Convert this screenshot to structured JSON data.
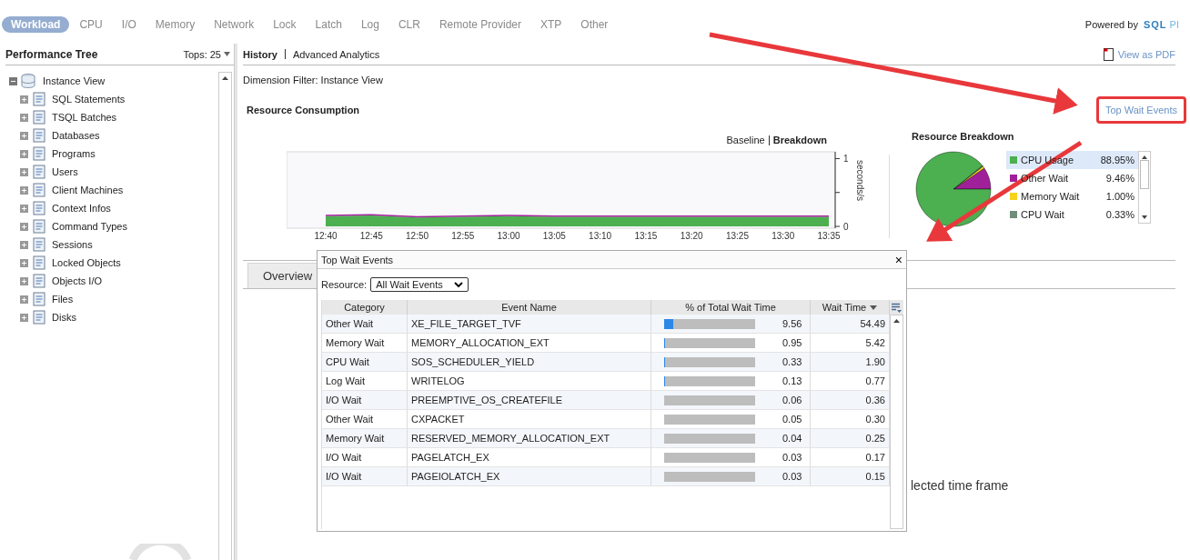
{
  "top_tabs": [
    {
      "label": "Workload",
      "selected": true
    },
    {
      "label": "CPU",
      "selected": false
    },
    {
      "label": "I/O",
      "selected": false
    },
    {
      "label": "Memory",
      "selected": false
    },
    {
      "label": "Network",
      "selected": false
    },
    {
      "label": "Lock",
      "selected": false
    },
    {
      "label": "Latch",
      "selected": false
    },
    {
      "label": "Log",
      "selected": false
    },
    {
      "label": "CLR",
      "selected": false
    },
    {
      "label": "Remote Provider",
      "selected": false
    },
    {
      "label": "XTP",
      "selected": false
    },
    {
      "label": "Other",
      "selected": false
    }
  ],
  "powered_by": {
    "label": "Powered by",
    "logo_main": "SQL",
    "logo_sub": "PI"
  },
  "performance_tree": {
    "title": "Performance Tree",
    "tops_label": "Tops:",
    "tops_value": "25",
    "items": [
      {
        "label": "Instance View",
        "expanded": true,
        "children": [
          {
            "label": "SQL Statements",
            "expanded": false
          },
          {
            "label": "TSQL Batches",
            "expanded": false
          },
          {
            "label": "Databases",
            "expanded": false
          },
          {
            "label": "Programs",
            "expanded": false
          },
          {
            "label": "Users",
            "expanded": false
          },
          {
            "label": "Client Machines",
            "expanded": false
          },
          {
            "label": "Context Infos",
            "expanded": false
          },
          {
            "label": "Command Types",
            "expanded": false
          },
          {
            "label": "Sessions",
            "expanded": false
          },
          {
            "label": "Locked Objects",
            "expanded": false
          },
          {
            "label": "Objects I/O",
            "expanded": false
          },
          {
            "label": "Files",
            "expanded": false
          },
          {
            "label": "Disks",
            "expanded": false
          }
        ]
      }
    ]
  },
  "view_tabs": [
    {
      "label": "History",
      "selected": true
    },
    {
      "label": "Advanced Analytics",
      "selected": false
    }
  ],
  "view_as_pdf": "View as PDF",
  "dimension_filter": "Dimension Filter: Instance View",
  "resource_consumption": {
    "title": "Resource Consumption",
    "top_wait_events_link": "Top Wait Events",
    "mode_tabs": [
      {
        "label": "Baseline",
        "selected": false
      },
      {
        "label": "Breakdown",
        "selected": true
      }
    ],
    "chart_data": {
      "type": "area",
      "ylabel": "seconds/s",
      "x": [
        "12:40",
        "12:45",
        "12:50",
        "12:55",
        "13:00",
        "13:05",
        "13:10",
        "13:15",
        "13:20",
        "13:25",
        "13:30",
        "13:35"
      ],
      "yticks": [
        0,
        1
      ],
      "ylim": [
        0,
        1.1
      ],
      "stacked": true,
      "series": [
        {
          "color": "#4caf50",
          "values": [
            0.15,
            0.16,
            0.13,
            0.14,
            0.15,
            0.14,
            0.14,
            0.14,
            0.14,
            0.14,
            0.14,
            0.14
          ]
        },
        {
          "color": "#a0209a",
          "values": [
            0.02,
            0.02,
            0.02,
            0.02,
            0.02,
            0.02,
            0.02,
            0.02,
            0.02,
            0.02,
            0.02,
            0.02
          ]
        }
      ]
    }
  },
  "resource_breakdown": {
    "title": "Resource Breakdown",
    "chart_data": {
      "type": "pie",
      "legend": "right",
      "categories": [
        "CPU Usage",
        "Other Wait",
        "Memory Wait",
        "CPU Wait"
      ],
      "series": [
        {
          "values": [
            88.95,
            9.46,
            1.0,
            0.33
          ]
        }
      ]
    },
    "legend": [
      {
        "value": "88.95%",
        "color": "#4caf50",
        "selected": true
      },
      {
        "value": "9.46%",
        "color": "#a0209a",
        "selected": false
      },
      {
        "value": "1.00%",
        "color": "#f5d31c",
        "selected": false
      },
      {
        "value": "0.33%",
        "color": "#6f8f7a",
        "selected": false
      }
    ]
  },
  "lower_tabs": [
    {
      "label": "Overview",
      "selected": true
    }
  ],
  "background_message": "lected time frame",
  "top_wait_events_dialog": {
    "title": "Top Wait Events",
    "close": "×",
    "resource_label": "Resource:",
    "resource_value": "All Wait Events",
    "columns": [
      "Category",
      "Event Name",
      "% of Total Wait Time",
      "Wait Time"
    ],
    "rows": [
      {
        "category": "Other Wait",
        "event": "XE_FILE_TARGET_TVF",
        "percent": "9.56",
        "level": 0.0956,
        "wait_time": "54.49"
      },
      {
        "category": "Memory Wait",
        "event": "MEMORY_ALLOCATION_EXT",
        "percent": "0.95",
        "level": 0.0095,
        "wait_time": "5.42"
      },
      {
        "category": "CPU Wait",
        "event": "SOS_SCHEDULER_YIELD",
        "percent": "0.33",
        "level": 0.0033,
        "wait_time": "1.90"
      },
      {
        "category": "Log Wait",
        "event": "WRITELOG",
        "percent": "0.13",
        "level": 0.0013,
        "wait_time": "0.77"
      },
      {
        "category": "I/O Wait",
        "event": "PREEMPTIVE_OS_CREATEFILE",
        "percent": "0.06",
        "level": 0.0006,
        "wait_time": "0.36"
      },
      {
        "category": "Other Wait",
        "event": "CXPACKET",
        "percent": "0.05",
        "level": 0.0005,
        "wait_time": "0.30"
      },
      {
        "category": "Memory Wait",
        "event": "RESERVED_MEMORY_ALLOCATION_EXT",
        "percent": "0.04",
        "level": 0.0004,
        "wait_time": "0.25"
      },
      {
        "category": "I/O Wait",
        "event": "PAGELATCH_EX",
        "percent": "0.03",
        "level": 0.0003,
        "wait_time": "0.17"
      },
      {
        "category": "I/O Wait",
        "event": "PAGEIOLATCH_EX",
        "percent": "0.03",
        "level": 0.0003,
        "wait_time": "0.15"
      }
    ]
  }
}
